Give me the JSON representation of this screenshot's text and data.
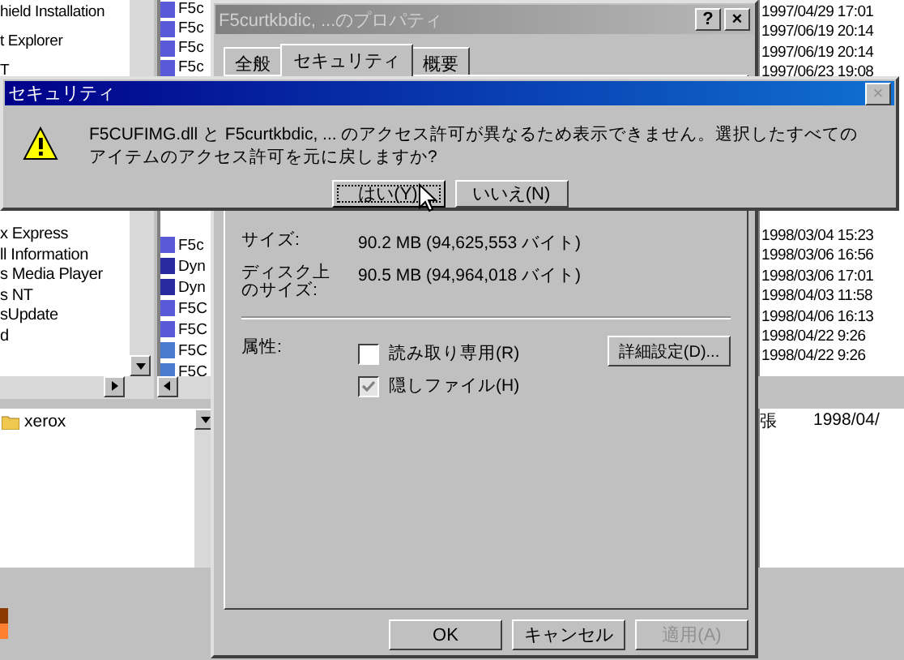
{
  "explorer": {
    "tree_items_top": [
      "hield Installation",
      "t Explorer",
      "T"
    ],
    "tree_items_bottom": [
      "x Express",
      "ll Information",
      "s Media Player",
      "s NT",
      "sUpdate",
      "d"
    ],
    "file_items_top": [
      {
        "label": "F5c",
        "kind": "doc"
      },
      {
        "label": "F5c",
        "kind": "doc"
      },
      {
        "label": "F5c",
        "kind": "doc"
      },
      {
        "label": "F5c",
        "kind": "doc"
      }
    ],
    "file_items_bottom": [
      {
        "label": "F5c",
        "kind": "doc"
      },
      {
        "label": "Dyn",
        "kind": "image"
      },
      {
        "label": "Dyn",
        "kind": "image"
      },
      {
        "label": "F5C",
        "kind": "doc"
      },
      {
        "label": "F5C",
        "kind": "doc"
      },
      {
        "label": "F5C",
        "kind": "dll"
      },
      {
        "label": "F5C",
        "kind": "dll"
      }
    ],
    "dates_top": [
      "1997/04/29 17:01",
      "1997/06/19 20:14",
      "1997/06/19 20:14",
      "1997/06/23 19:08"
    ],
    "dates_bottom": [
      "1998/03/04 15:23",
      "1998/03/06 16:56",
      "1998/03/06 17:01",
      "1998/04/03 11:58",
      "1998/04/06 16:13",
      "1998/04/22 9:26",
      "1998/04/22 9:26"
    ],
    "lower_folders": [
      "xerox"
    ],
    "lower_list": [
      {
        "column_1": "張",
        "column_2": "1998/04/"
      }
    ]
  },
  "properties_dialog": {
    "title": "F5curtkbdic, ...のプロパティ",
    "help_button": "?",
    "close_button": "×",
    "tabs": [
      {
        "label": "全般",
        "selected": false
      },
      {
        "label": "セキュリティ",
        "selected": true
      },
      {
        "label": "概要",
        "selected": false
      }
    ],
    "size_label": "サイズ:",
    "size_value": "90.2 MB (94,625,553 バイト)",
    "disk_size_label": "ディスク上のサイズ:",
    "disk_size_value": "90.5 MB (94,964,018 バイト)",
    "attributes_label": "属性:",
    "attributes": [
      {
        "label": "読み取り専用(R)",
        "checked": false,
        "disabled": false
      },
      {
        "label": "隠しファイル(H)",
        "checked": true,
        "disabled": true
      }
    ],
    "advanced_button": "詳細設定(D)...",
    "buttons": [
      {
        "label": "OK",
        "disabled": false
      },
      {
        "label": "キャンセル",
        "disabled": false
      },
      {
        "label": "適用(A)",
        "disabled": true
      }
    ]
  },
  "message_box": {
    "title": "セキュリティ",
    "close_button": "×",
    "message": "F5CUFIMG.dll と F5curtkbdic, ... のアクセス許可が異なるため表示できません。選択したすべてのアイテムのアクセス許可を元に戻しますか?",
    "buttons": [
      {
        "label": "はい(Y)",
        "selected": true
      },
      {
        "label": "いいえ(N)",
        "selected": false
      }
    ]
  }
}
